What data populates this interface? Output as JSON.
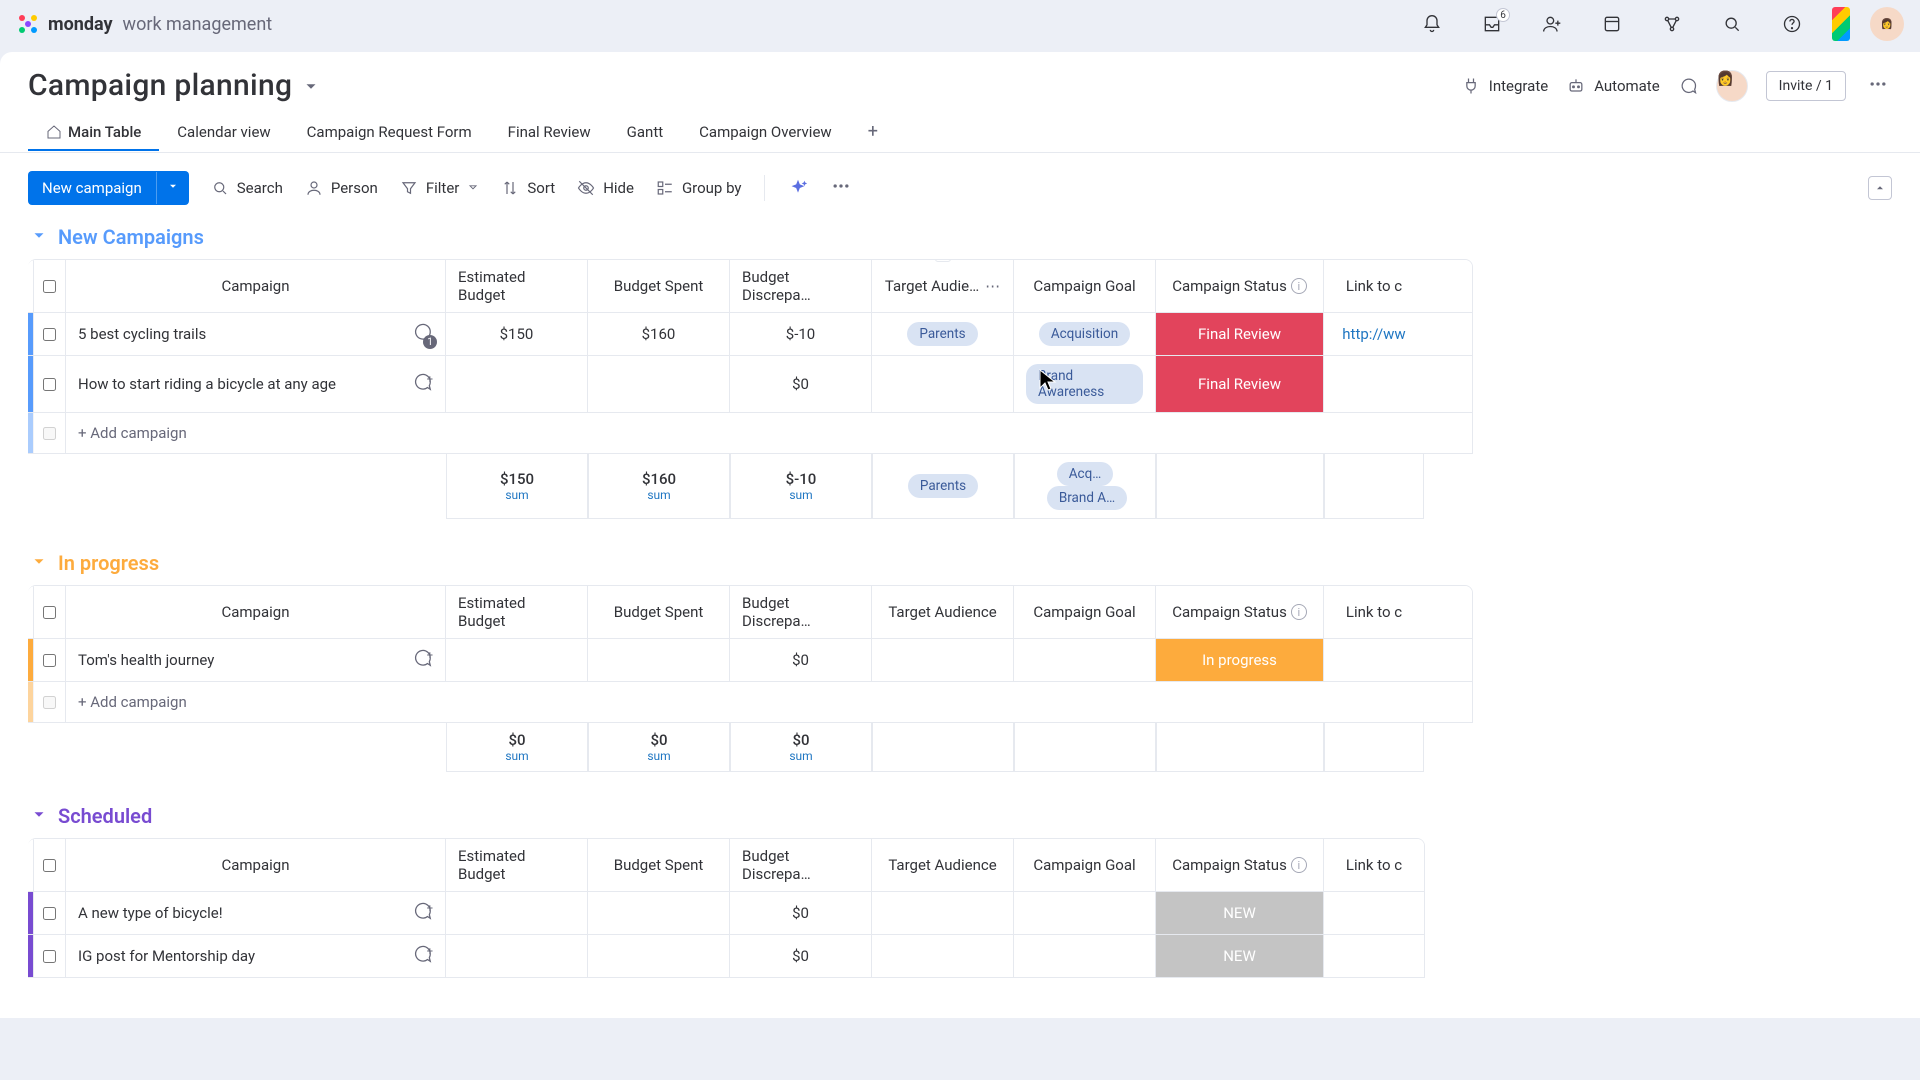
{
  "brand": {
    "name_bold": "monday",
    "name_light": "work management"
  },
  "topbar": {
    "inbox_badge": "6"
  },
  "board": {
    "title": "Campaign planning",
    "integrate": "Integrate",
    "automate": "Automate",
    "invite": "Invite / 1"
  },
  "tabs": [
    {
      "label": "Main Table",
      "active": true,
      "home": true
    },
    {
      "label": "Calendar view"
    },
    {
      "label": "Campaign Request Form"
    },
    {
      "label": "Final Review"
    },
    {
      "label": "Gantt"
    },
    {
      "label": "Campaign Overview"
    }
  ],
  "toolbar": {
    "new": "New campaign",
    "search": "Search",
    "person": "Person",
    "filter": "Filter",
    "sort": "Sort",
    "hide": "Hide",
    "group_by": "Group by"
  },
  "columns": {
    "campaign": "Campaign",
    "est_budget": "Estimated Budget",
    "budget_spent": "Budget Spent",
    "budget_disc": "Budget Discrepa…",
    "target_aud": "Target Audie…",
    "target_aud_full": "Target Audience",
    "goal": "Campaign Goal",
    "status": "Campaign Status",
    "link": "Link to c"
  },
  "add_row": "+ Add campaign",
  "sum_label": "sum",
  "groups": [
    {
      "id": "new",
      "title": "New Campaigns",
      "cls": "g-new",
      "rows": [
        {
          "name": "5 best cycling trails",
          "conv_count": "1",
          "est": "$150",
          "spent": "$160",
          "disc": "$-10",
          "aud": [
            "Parents"
          ],
          "goal": [
            "Acquisition"
          ],
          "status": "Final Review",
          "status_cls": "st-final",
          "link": "http://ww"
        },
        {
          "name": "How to start riding a bicycle at any age",
          "conv_plus": true,
          "est": "",
          "spent": "",
          "disc": "$0",
          "aud": [],
          "goal": [
            "Brand Awareness"
          ],
          "status": "Final Review",
          "status_cls": "st-final",
          "link": ""
        }
      ],
      "sum": {
        "est": "$150",
        "spent": "$160",
        "disc": "$-10",
        "aud": [
          "Parents"
        ],
        "goal": [
          "Acq…",
          "Brand A…"
        ]
      }
    },
    {
      "id": "prog",
      "title": "In progress",
      "cls": "g-prog",
      "rows": [
        {
          "name": "Tom's health journey",
          "conv_plus": true,
          "est": "",
          "spent": "",
          "disc": "$0",
          "aud": [],
          "goal": [],
          "status": "In progress",
          "status_cls": "st-prog",
          "link": ""
        }
      ],
      "sum": {
        "est": "$0",
        "spent": "$0",
        "disc": "$0",
        "aud": [],
        "goal": []
      }
    },
    {
      "id": "sched",
      "title": "Scheduled",
      "cls": "g-sched",
      "rows": [
        {
          "name": "A new type of bicycle!",
          "conv_plus": true,
          "est": "",
          "spent": "",
          "disc": "$0",
          "aud": [],
          "goal": [],
          "status": "NEW",
          "status_cls": "st-new",
          "link": ""
        },
        {
          "name": "IG post for Mentorship day",
          "conv_plus": true,
          "est": "",
          "spent": "",
          "disc": "$0",
          "aud": [],
          "goal": [],
          "status": "NEW",
          "status_cls": "st-new",
          "link": ""
        }
      ],
      "sum": null
    }
  ]
}
